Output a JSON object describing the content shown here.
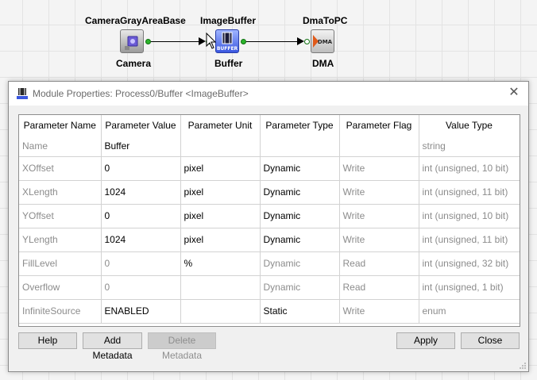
{
  "pipeline": {
    "nodes": [
      {
        "title": "CameraGrayAreaBase",
        "label": "Camera",
        "icon": "camera-module-icon"
      },
      {
        "title": "ImageBuffer",
        "label": "Buffer",
        "icon": "buffer-module-icon",
        "icon_text": "BUFFER"
      },
      {
        "title": "DmaToPC",
        "label": "DMA",
        "icon": "dma-module-icon",
        "icon_text": "DMA"
      }
    ]
  },
  "dialog": {
    "title": "Module Properties: Process0/Buffer <ImageBuffer>",
    "close_glyph": "✕",
    "columns": [
      "Parameter Name",
      "Parameter Value",
      "Parameter Unit",
      "Parameter Type",
      "Parameter Flag",
      "Value Type"
    ],
    "rows": [
      {
        "name": "Name",
        "value": "Buffer",
        "unit": "",
        "type": "",
        "flag": "",
        "value_type": "string",
        "editable": true
      },
      {
        "name": "XOffset",
        "value": "0",
        "unit": "pixel",
        "type": "Dynamic",
        "flag": "Write",
        "value_type": "int (unsigned, 10 bit)",
        "editable": true
      },
      {
        "name": "XLength",
        "value": "1024",
        "unit": "pixel",
        "type": "Dynamic",
        "flag": "Write",
        "value_type": "int (unsigned, 11 bit)",
        "editable": true
      },
      {
        "name": "YOffset",
        "value": "0",
        "unit": "pixel",
        "type": "Dynamic",
        "flag": "Write",
        "value_type": "int (unsigned, 10 bit)",
        "editable": true
      },
      {
        "name": "YLength",
        "value": "1024",
        "unit": "pixel",
        "type": "Dynamic",
        "flag": "Write",
        "value_type": "int (unsigned, 11 bit)",
        "editable": true
      },
      {
        "name": "FillLevel",
        "value": "0",
        "unit": "%",
        "type": "Dynamic",
        "flag": "Read",
        "value_type": "int (unsigned, 32 bit)",
        "editable": false
      },
      {
        "name": "Overflow",
        "value": "0",
        "unit": "",
        "type": "Dynamic",
        "flag": "Read",
        "value_type": "int (unsigned, 1 bit)",
        "editable": false
      },
      {
        "name": "InfiniteSource",
        "value": "ENABLED",
        "unit": "",
        "type": "Static",
        "flag": "Write",
        "value_type": "enum",
        "editable": true
      }
    ],
    "buttons": {
      "help": "Help",
      "add_metadata": "Add Metadata",
      "delete_metadata": "Delete Metadata",
      "apply": "Apply",
      "close": "Close"
    }
  },
  "colors": {
    "port": "#2bb52b",
    "buffer_tile": "#3a57e0",
    "dma_accent": "#e05a1a",
    "dim_text": "#8c8c8c"
  }
}
